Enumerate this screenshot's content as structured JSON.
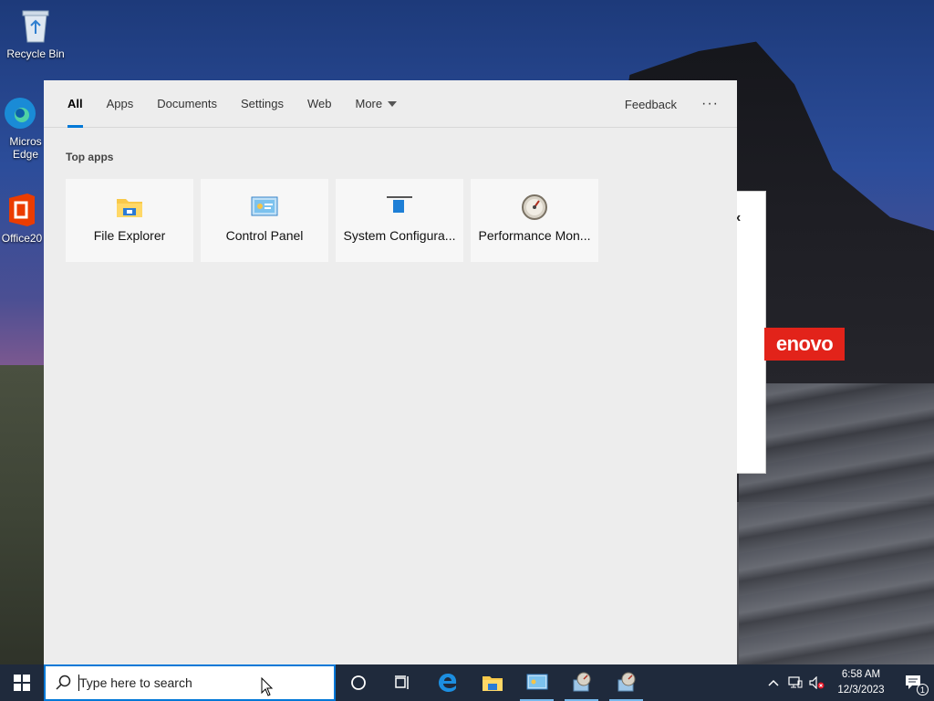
{
  "desktop": {
    "icons": [
      {
        "label": "Recycle Bin"
      },
      {
        "label": "Micros Edge"
      },
      {
        "label": "Office20"
      }
    ],
    "lenovo_text": "enovo"
  },
  "search_panel": {
    "tabs": [
      {
        "label": "All",
        "active": true
      },
      {
        "label": "Apps"
      },
      {
        "label": "Documents"
      },
      {
        "label": "Settings"
      },
      {
        "label": "Web"
      },
      {
        "label": "More"
      }
    ],
    "feedback": "Feedback",
    "more_options": "···",
    "section_title": "Top apps",
    "top_apps": [
      {
        "name": "File Explorer",
        "icon": "folder-icon"
      },
      {
        "name": "Control Panel",
        "icon": "control-panel-icon"
      },
      {
        "name": "System Configura...",
        "icon": "system-config-icon"
      },
      {
        "name": "Performance Mon...",
        "icon": "performance-monitor-icon"
      }
    ]
  },
  "taskbar": {
    "search_placeholder": "Type here to search",
    "pinned": [
      "cortana-icon",
      "task-view-icon",
      "edge-icon",
      "file-explorer-icon",
      "control-panel-icon",
      "performance-monitor-icon",
      "performance-monitor-icon"
    ],
    "clock": {
      "time": "6:58 AM",
      "date": "12/3/2023"
    },
    "notification_count": "1"
  },
  "colors": {
    "accent": "#0078d7",
    "taskbar": "#1f2a3c",
    "panel_bg": "#ededed",
    "lenovo_red": "#e2231a"
  }
}
